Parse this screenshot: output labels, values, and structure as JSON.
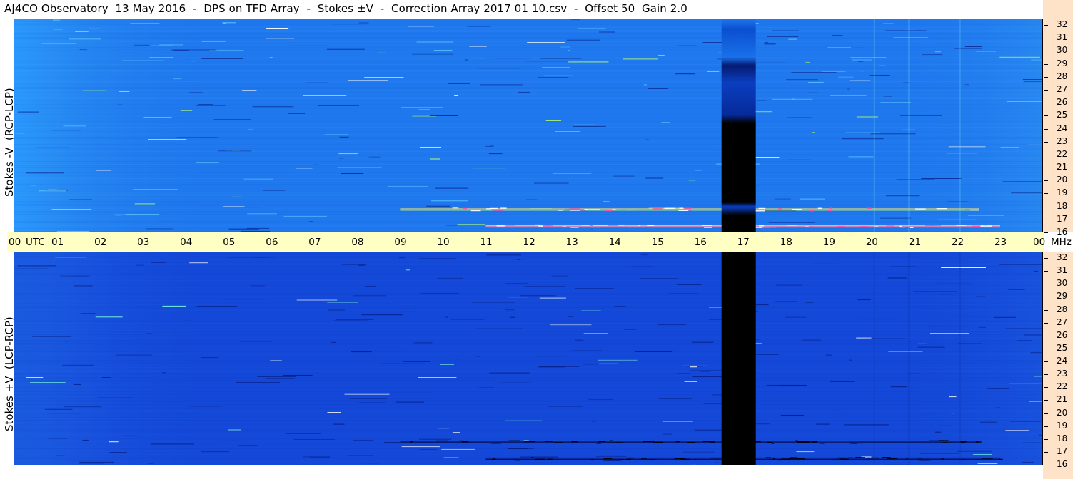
{
  "title": "AJ4CO Observatory  13 May 2016  -  DPS on TFD Array  -  Stokes ±V  -  Correction Array 2017 01 10.csv  -  Offset 50  Gain 2.0",
  "colors": {
    "top_panel_base": "#1f78ee",
    "bottom_panel_base": "#1448d8",
    "time_axis_band": "#ffffc4",
    "freq_axis_band": "#ffe3c8",
    "gap": "#000000"
  },
  "chart_data": [
    {
      "type": "heatmap",
      "ylabel": "Stokes -V  (RCP-LCP)",
      "xlabel": "UTC",
      "x_ticks": [
        "00",
        "01",
        "02",
        "03",
        "04",
        "05",
        "06",
        "07",
        "08",
        "09",
        "10",
        "11",
        "12",
        "13",
        "14",
        "15",
        "16",
        "17",
        "18",
        "19",
        "20",
        "21",
        "22",
        "23",
        "00"
      ],
      "xlim": [
        0,
        24
      ],
      "y_unit": "MHz",
      "y_ticks": [
        32,
        31,
        30,
        29,
        28,
        27,
        26,
        25,
        24,
        23,
        22,
        21,
        20,
        19,
        18,
        17,
        16
      ],
      "ylim": [
        16,
        32.5
      ],
      "data_gap_utc": [
        16.5,
        17.3
      ],
      "features": [
        {
          "frequency_mhz": 17.8,
          "utc_range": [
            9.0,
            22.5
          ],
          "description": "bright interference band"
        },
        {
          "frequency_mhz": 16.5,
          "utc_range": [
            11.0,
            23.0
          ],
          "description": "bright interference band"
        }
      ]
    },
    {
      "type": "heatmap",
      "ylabel": "Stokes +V  (LCP-RCP)",
      "xlabel": "UTC",
      "x_ticks": [
        "00",
        "01",
        "02",
        "03",
        "04",
        "05",
        "06",
        "07",
        "08",
        "09",
        "10",
        "11",
        "12",
        "13",
        "14",
        "15",
        "16",
        "17",
        "18",
        "19",
        "20",
        "21",
        "22",
        "23",
        "00"
      ],
      "xlim": [
        0,
        24
      ],
      "y_unit": "MHz",
      "y_ticks": [
        32,
        31,
        30,
        29,
        28,
        27,
        26,
        25,
        24,
        23,
        22,
        21,
        20,
        19,
        18,
        17,
        16
      ],
      "ylim": [
        16,
        32.5
      ],
      "data_gap_utc": [
        16.5,
        17.3
      ],
      "features": [
        {
          "frequency_mhz": 17.8,
          "utc_range": [
            9.0,
            22.5
          ],
          "description": "dark interference band"
        },
        {
          "frequency_mhz": 16.5,
          "utc_range": [
            11.0,
            23.0
          ],
          "description": "dark interference band"
        }
      ]
    }
  ]
}
